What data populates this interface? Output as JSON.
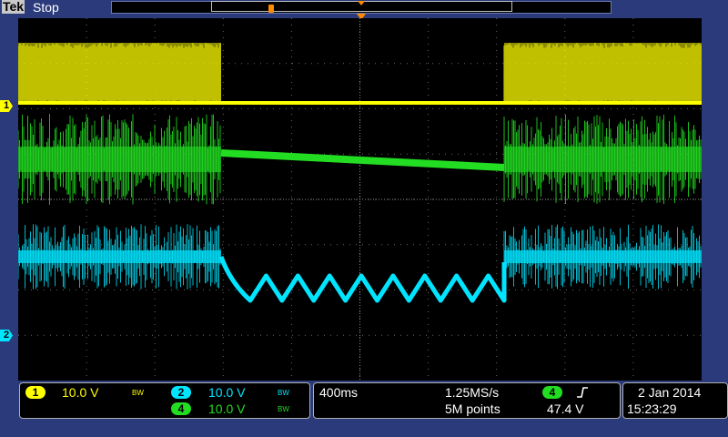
{
  "header": {
    "brand": "Tek",
    "status": "Stop"
  },
  "markers": {
    "ch1": "1",
    "ch2": "2"
  },
  "channels": [
    {
      "id": "1",
      "scale": "10.0 V",
      "bw": "BW",
      "color": "#ffff00"
    },
    {
      "id": "2",
      "scale": "10.0 V",
      "bw": "BW",
      "color": "#00e5ff"
    },
    {
      "id": "4",
      "scale": "10.0 V",
      "bw": "BW",
      "color": "#22dd22"
    }
  ],
  "horizontal": {
    "timebase": "400ms",
    "sample_rate": "1.25MS/s",
    "record_length": "5M points"
  },
  "trigger": {
    "source": "4",
    "slope_icon": "rising-edge",
    "level": "47.4 V"
  },
  "datetime": {
    "date": "2 Jan 2014",
    "time": "15:23:29"
  },
  "colors": {
    "ch1": "#ffff00",
    "ch2": "#00e5ff",
    "ch4": "#22dd22",
    "trigger": "#ff8c00"
  }
}
